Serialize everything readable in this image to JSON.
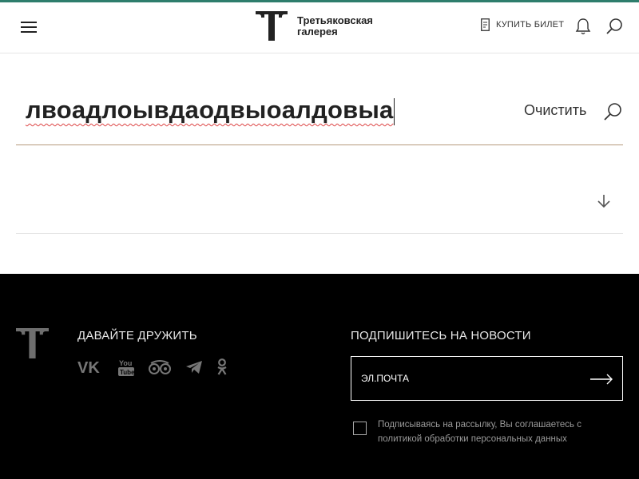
{
  "header": {
    "logo_line1": "Третьяковская",
    "logo_line2": "галерея",
    "buy_ticket": "КУПИТЬ БИЛЕТ"
  },
  "search": {
    "query": "лвоадлоывдаодвыоалдовыа",
    "clear_label": "Очистить"
  },
  "footer": {
    "friends_title": "ДАВАЙТЕ ДРУЖИТЬ",
    "socials": [
      "vk-icon",
      "youtube-icon",
      "tripadvisor-icon",
      "telegram-icon",
      "odnoklassniki-icon"
    ],
    "newsletter_title": "ПОДПИШИТЕСЬ НА НОВОСТИ",
    "email_placeholder": "ЭЛ.ПОЧТА",
    "consent_text": "Подписываясь на рассылку, Вы соглашаетесь с политикой обработки персональных данных"
  },
  "colors": {
    "accent_line": "#2e7d6c",
    "search_underline": "#b59a7c",
    "footer_bg": "#000000"
  }
}
